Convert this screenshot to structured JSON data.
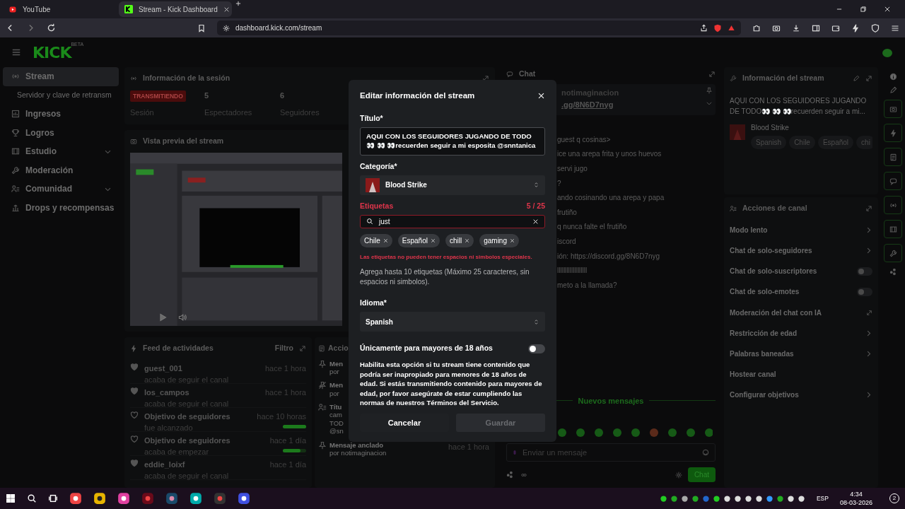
{
  "browser": {
    "tabs": [
      {
        "title": "YouTube",
        "selected": false
      },
      {
        "title": "Stream - Kick Dashboard",
        "selected": true
      }
    ],
    "url": "dashboard.kick.com/stream"
  },
  "header": {
    "logo": "KICK",
    "logo_tag": "BETA"
  },
  "sidebar": {
    "items": [
      {
        "label": "Stream",
        "selected": true,
        "expandable": false
      },
      {
        "label": "Servidor y clave de retransm",
        "selected": false,
        "expandable": false
      },
      {
        "label": "Ingresos",
        "selected": false,
        "expandable": false
      },
      {
        "label": "Logros",
        "selected": false,
        "expandable": false
      },
      {
        "label": "Estudio",
        "selected": false,
        "expandable": true
      },
      {
        "label": "Moderación",
        "selected": false,
        "expandable": false
      },
      {
        "label": "Comunidad",
        "selected": false,
        "expandable": true
      },
      {
        "label": "Drops y recompensas",
        "selected": false,
        "expandable": false
      }
    ]
  },
  "session": {
    "title": "Información de la sesión",
    "badge": "TRANSMITIENDO",
    "badge_label": "Sesión",
    "stats": [
      {
        "value": "5",
        "label": "Espectadores"
      },
      {
        "value": "6",
        "label": "Seguidores"
      }
    ]
  },
  "preview": {
    "title": "Vista previa del stream",
    "kind": "picture"
  },
  "feed": {
    "title": "Feed de actividades",
    "filter": "Filtro",
    "items": [
      {
        "kind": "follow",
        "name": "guest_001",
        "detail": "acaba de seguir el canal",
        "time": "hace 1 hora"
      },
      {
        "kind": "follow",
        "name": "los_campos",
        "detail": "acaba de seguir el canal",
        "time": "hace 1 hora"
      },
      {
        "kind": "goal",
        "name": "Objetivo de seguidores",
        "detail": "fue alcanzado",
        "time": "hace 10 horas",
        "level": 1
      },
      {
        "kind": "goal",
        "name": "Objetivo de seguidores",
        "detail": "acaba de empezar",
        "time": "hace 1 día",
        "level": 0.75
      },
      {
        "kind": "follow",
        "name": "eddie_loixf",
        "detail": "acaba de seguir el canal",
        "time": "hace 1 día"
      }
    ]
  },
  "actions_log": {
    "title": "Accio",
    "items": [
      {
        "lines": [
          "Men",
          "por"
        ]
      },
      {
        "lines": [
          "Men",
          "por"
        ]
      },
      {
        "lines": [
          "Títu",
          "cam",
          "TOD",
          "@sn"
        ]
      },
      {
        "lines": [
          "Mensaje anclado",
          "por notimaginacion"
        ],
        "time": "hace 1 hora"
      }
    ]
  },
  "chat": {
    "title": "Chat",
    "pinned": {
      "user": "notimaginacion",
      "text": ".gg/8N6D7nyg"
    },
    "messages": [
      {
        "text": "guest q cosinas>"
      },
      {
        "text": "ice una arepa frita y unos huevos"
      },
      {
        "text": "servi jugo"
      },
      {
        "text": "?"
      },
      {
        "text": "ando cosinando una arepa y papa"
      },
      {
        "text": "frutiño"
      },
      {
        "text": "q nunca falte el frutiño"
      },
      {
        "text": "iscord"
      },
      {
        "text": "ión: ",
        "link": "https://discord.gg/8N6D7nyg"
      },
      {
        "text": "lllllllllllllllllll"
      },
      {
        "text": "meto a la llamada?"
      }
    ],
    "new_messages": "Nuevos mensajes",
    "input_placeholder": "Enviar un mensaje",
    "send": "Chat"
  },
  "stream_info": {
    "title": "Información del stream",
    "stream_title": "AQUI CON LOS SEGUIDORES JUGANDO DE TODO👀 👀 👀recuerden seguir a mi...",
    "category": "Blood Strike",
    "tags": [
      "Spanish",
      "Chile",
      "Español",
      "chi"
    ]
  },
  "channel_actions": {
    "title": "Acciones de canal",
    "items": [
      {
        "label": "Modo lento",
        "kind": "arrow"
      },
      {
        "label": "Chat de solo-seguidores",
        "kind": "arrow"
      },
      {
        "label": "Chat de solo-suscriptores",
        "kind": "toggle",
        "on": false
      },
      {
        "label": "Chat de solo-emotes",
        "kind": "toggle",
        "on": false
      },
      {
        "label": "Moderación del chat con IA",
        "kind": "external"
      },
      {
        "label": "Restricción de edad",
        "kind": "arrow"
      },
      {
        "label": "Palabras baneadas",
        "kind": "arrow"
      },
      {
        "label": "Hostear canal",
        "kind": "plain"
      },
      {
        "label": "Configurar objetivos",
        "kind": "arrow"
      }
    ]
  },
  "modal": {
    "title": "Editar información del stream",
    "title_field": {
      "label": "Título*",
      "value": "AQUI CON LOS SEGUIDORES JUGANDO DE TODO👀 👀 👀recuerden seguir a mi esposita @snntanica"
    },
    "category": {
      "label": "Categoría*",
      "value": "Blood Strike"
    },
    "tags": {
      "label": "Etiquetas",
      "counter": "5 / 25",
      "error": true,
      "value": "just",
      "chips": [
        "Chile",
        "Español",
        "chill",
        "gaming"
      ],
      "error_text": "Las etiquetas no pueden tener espacios ni simbolos especiales.",
      "help": "Agrega hasta 10 etiquetas (Máximo 25 caracteres, sin espacios ni simbolos)."
    },
    "language": {
      "label": "Idioma*",
      "value": "Spanish"
    },
    "adult": {
      "label": "Únicamente para mayores de 18 años",
      "on": false,
      "description": "Habilita esta opción si tu stream tiene contenido que podría ser inapropiado para menores de 18 años de edad. Si estás transmitiendo contenido para mayores de edad, por favor asegúrate de estar cumpliendo las normas de nuestros ",
      "link": "Términos del Servicio",
      "end": "."
    },
    "cancel": "Cancelar",
    "save": {
      "label": "Guardar",
      "disabled": true
    }
  },
  "taskbar": {
    "language": "ESP",
    "time": "4:34",
    "date": "08-03-2026",
    "notifications": "2"
  }
}
